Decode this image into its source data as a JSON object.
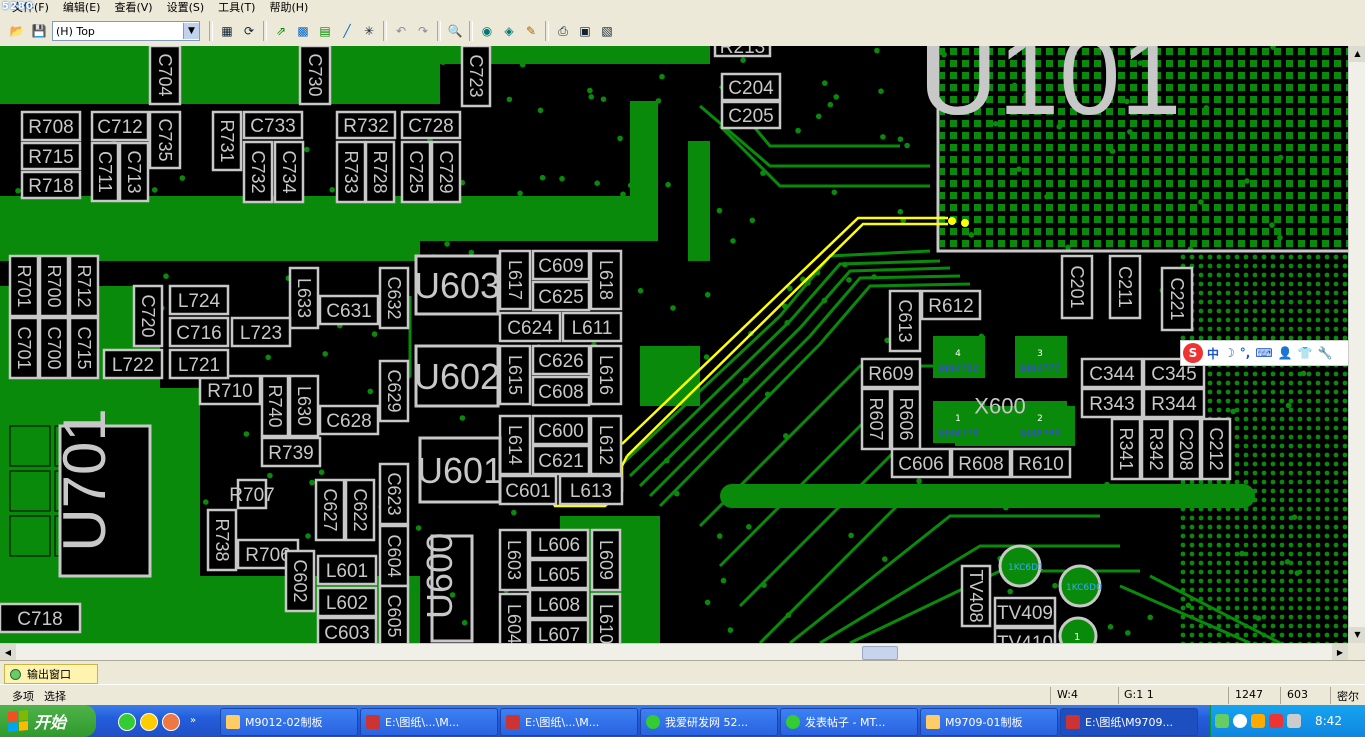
{
  "app": {
    "logo": "5280"
  },
  "menu": [
    "文件(F)",
    "编辑(E)",
    "查看(V)",
    "设置(S)",
    "工具(T)",
    "帮助(H)"
  ],
  "toolbar": {
    "layer_value": "(H) Top",
    "icons": [
      "open-icon",
      "save-icon",
      "properties-icon",
      "redraw-icon",
      "route-icon",
      "pour-icon",
      "layer-icon",
      "trace-icon",
      "snap-icon",
      "undo-icon",
      "redo-icon",
      "zoom-icon",
      "board-icon",
      "select-icon",
      "edit-icon",
      "print-icon",
      "report-icon",
      "verify-icon"
    ]
  },
  "colors": {
    "board": "#000000",
    "copper": "#0a8a0a",
    "silk": "#c8c8c8",
    "highlight": "#ffff00"
  },
  "pcb": {
    "components": [
      {
        "ref": "U601",
        "big": true
      },
      {
        "ref": "U602",
        "big": true
      },
      {
        "ref": "U603",
        "big": true
      },
      {
        "ref": "U600",
        "big": true
      },
      {
        "ref": "U701",
        "big": true
      },
      {
        "ref": "X600",
        "big": true
      },
      {
        "ref": "U101",
        "big": true
      },
      {
        "ref": "C204"
      },
      {
        "ref": "C205"
      },
      {
        "ref": "C704"
      },
      {
        "ref": "C730"
      },
      {
        "ref": "C723"
      },
      {
        "ref": "R708"
      },
      {
        "ref": "C712"
      },
      {
        "ref": "C735"
      },
      {
        "ref": "R715"
      },
      {
        "ref": "C711"
      },
      {
        "ref": "C713"
      },
      {
        "ref": "R718"
      },
      {
        "ref": "R731"
      },
      {
        "ref": "C733"
      },
      {
        "ref": "C732"
      },
      {
        "ref": "C734"
      },
      {
        "ref": "R732"
      },
      {
        "ref": "R733"
      },
      {
        "ref": "R728"
      },
      {
        "ref": "C728"
      },
      {
        "ref": "C725"
      },
      {
        "ref": "C729"
      },
      {
        "ref": "C609"
      },
      {
        "ref": "L617"
      },
      {
        "ref": "L618"
      },
      {
        "ref": "C625"
      },
      {
        "ref": "C624"
      },
      {
        "ref": "L611"
      },
      {
        "ref": "C626"
      },
      {
        "ref": "L615"
      },
      {
        "ref": "L616"
      },
      {
        "ref": "C608"
      },
      {
        "ref": "C621"
      },
      {
        "ref": "L614"
      },
      {
        "ref": "L612"
      },
      {
        "ref": "C601"
      },
      {
        "ref": "L613"
      },
      {
        "ref": "C600"
      },
      {
        "ref": "L633"
      },
      {
        "ref": "C631"
      },
      {
        "ref": "C632"
      },
      {
        "ref": "C629"
      },
      {
        "ref": "L630"
      },
      {
        "ref": "C628"
      },
      {
        "ref": "R739"
      },
      {
        "ref": "R740"
      },
      {
        "ref": "R710"
      },
      {
        "ref": "C720"
      },
      {
        "ref": "L724"
      },
      {
        "ref": "C716"
      },
      {
        "ref": "L723"
      },
      {
        "ref": "L722"
      },
      {
        "ref": "L721"
      },
      {
        "ref": "R701"
      },
      {
        "ref": "R700"
      },
      {
        "ref": "R712"
      },
      {
        "ref": "C701"
      },
      {
        "ref": "C700"
      },
      {
        "ref": "C715"
      },
      {
        "ref": "R707"
      },
      {
        "ref": "R738"
      },
      {
        "ref": "R706"
      },
      {
        "ref": "C627"
      },
      {
        "ref": "C622"
      },
      {
        "ref": "C623"
      },
      {
        "ref": "C604"
      },
      {
        "ref": "C602"
      },
      {
        "ref": "L601"
      },
      {
        "ref": "L602"
      },
      {
        "ref": "C603"
      },
      {
        "ref": "C605"
      },
      {
        "ref": "C718"
      },
      {
        "ref": "L606"
      },
      {
        "ref": "L603"
      },
      {
        "ref": "L609"
      },
      {
        "ref": "L605"
      },
      {
        "ref": "L608"
      },
      {
        "ref": "L604"
      },
      {
        "ref": "L610"
      },
      {
        "ref": "L607"
      },
      {
        "ref": "C613"
      },
      {
        "ref": "R612"
      },
      {
        "ref": "R609"
      },
      {
        "ref": "R607"
      },
      {
        "ref": "R606"
      },
      {
        "ref": "C606"
      },
      {
        "ref": "R608"
      },
      {
        "ref": "R610"
      },
      {
        "ref": "C201"
      },
      {
        "ref": "C211"
      },
      {
        "ref": "C221"
      },
      {
        "ref": "C344"
      },
      {
        "ref": "C345"
      },
      {
        "ref": "R343"
      },
      {
        "ref": "R344"
      },
      {
        "ref": "R341"
      },
      {
        "ref": "R342"
      },
      {
        "ref": "C208"
      },
      {
        "ref": "C212"
      },
      {
        "ref": "TV408"
      },
      {
        "ref": "TV409"
      },
      {
        "ref": "TV410"
      },
      {
        "ref": "R213"
      }
    ],
    "x600_pads": [
      {
        "num": "4",
        "net": "$$$4782"
      },
      {
        "num": "3",
        "net": "$$$4777"
      },
      {
        "num": "1",
        "net": "$$$4778"
      },
      {
        "num": "2",
        "net": "$$$8783"
      }
    ],
    "small_labels": [
      "1KC6D1",
      "1KC6D0",
      "1"
    ]
  },
  "ime": {
    "logo": "S",
    "items": [
      "中",
      "☽",
      "°,",
      "⌨",
      "👤",
      "👕",
      "🔧"
    ]
  },
  "output_tab": "输出窗口",
  "status": {
    "mode_left": "多项",
    "mode_right": "选择",
    "w": "W:4",
    "g": "G:1 1",
    "x": "1247",
    "y": "603",
    "unit": "密尔"
  },
  "taskbar": {
    "start": "开始",
    "tasks": [
      "M9012-02制板",
      "E:\\图纸\\...\\M...",
      "E:\\图纸\\...\\M...",
      "我爱研发网 52...",
      "发表帖子 - MT...",
      "M9709-01制板",
      "E:\\图纸\\M9709..."
    ],
    "clock": "8:42"
  }
}
